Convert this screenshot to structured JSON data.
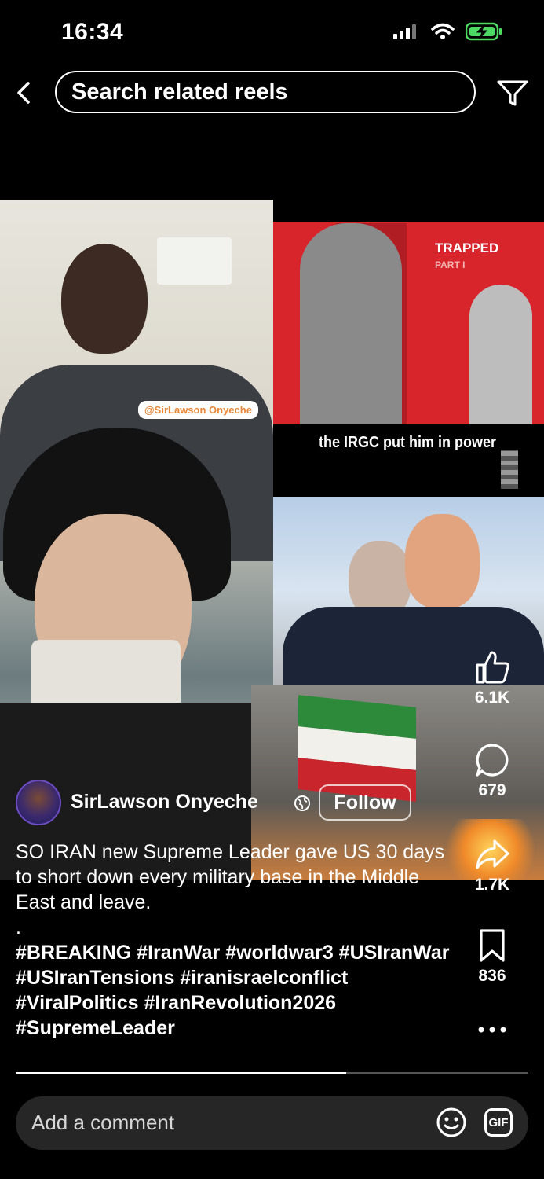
{
  "status": {
    "time": "16:34"
  },
  "header": {
    "search_label": "Search related reels"
  },
  "overlays": {
    "handle_badge": "@SirLawson Onyeche",
    "trapped_title": "TRAPPED",
    "trapped_subtitle": "PART I",
    "clip_caption": "the IRGC put him in power"
  },
  "actions": {
    "likes": "6.1K",
    "comments": "679",
    "shares": "1.7K",
    "saves": "836"
  },
  "post": {
    "author": "SirLawson Onyeche",
    "follow_label": "Follow",
    "caption": "SO IRAN new Supreme Leader gave US 30 days to short down every military base in the Middle East and leave.",
    "separator": ".",
    "hashtags": "#BREAKING #IranWar #worldwar3 #USIranWar #USIranTensions #iranisraelconflict #ViralPolitics #IranRevolution2026 #SupremeLeader",
    "progress": 0.645
  },
  "comment_bar": {
    "placeholder": "Add a comment",
    "gif_label": "GIF"
  },
  "colors": {
    "background": "#000000",
    "comment_bar": "#262626",
    "trapped_red": "#d8252b",
    "battery_green": "#4cd964"
  }
}
